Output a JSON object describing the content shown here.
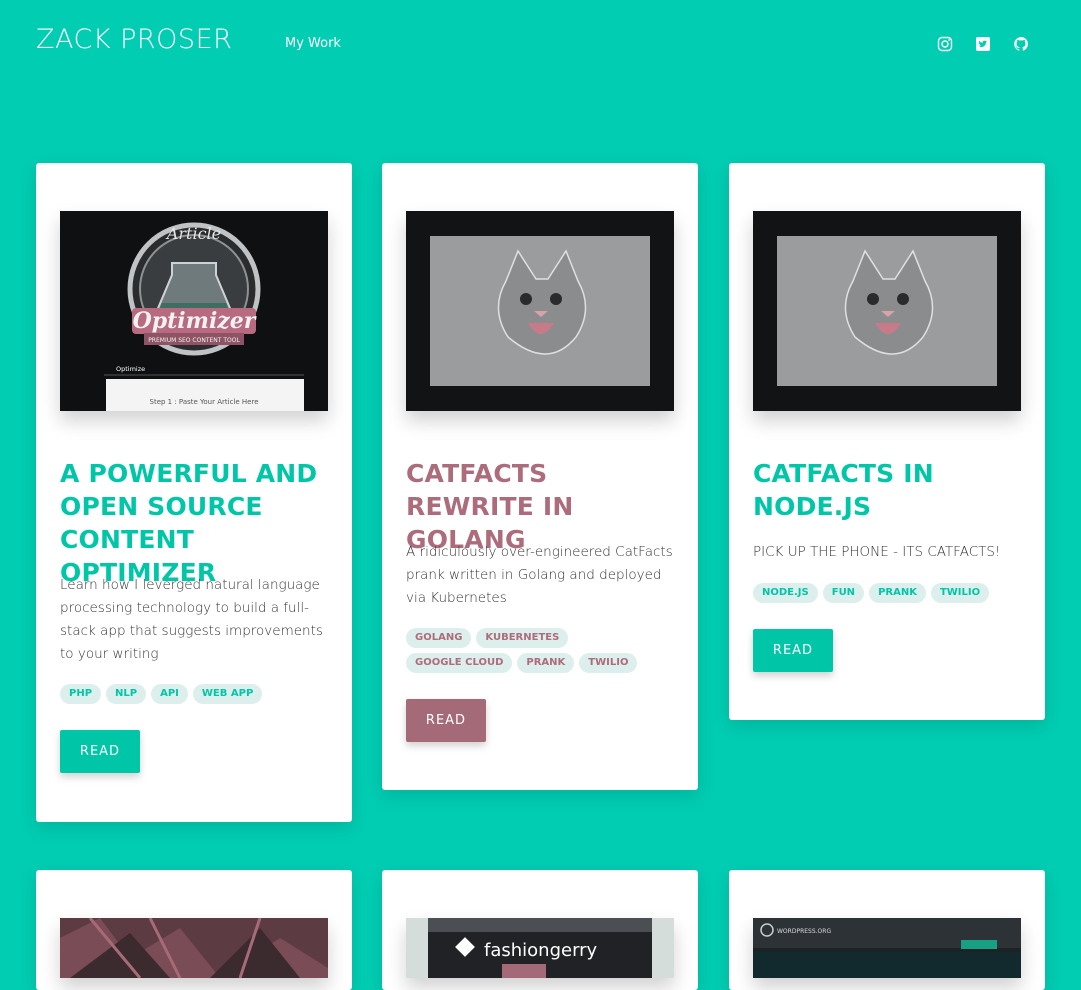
{
  "header": {
    "site_title": "ZACK PROSER",
    "nav_link": "My Work",
    "social_icons": [
      "instagram-icon",
      "twitter-icon",
      "github-icon"
    ]
  },
  "colors": {
    "background": "#00cdb2",
    "accent_green": "#00c6a8",
    "accent_mauve": "#a46a78"
  },
  "cards": [
    {
      "title": "A POWERFUL AND OPEN SOURCE CONTENT OPTIMIZER",
      "description": "Learn how I leverged natural language processing technology to build a full-stack app that suggests improvements to your writing",
      "tags": [
        "PHP",
        "NLP",
        "API",
        "WEB APP"
      ],
      "button": "READ",
      "image": {
        "logo_top": "Article",
        "logo_main": "Optimizer",
        "logo_banner": "PREMIUM SEO CONTENT TOOL",
        "tab_label": "Optimize",
        "step_text": "Step 1 : Paste Your Article Here"
      }
    },
    {
      "title": "CATFACTS REWRITE IN GOLANG",
      "description": "A ridiculously over-engineered CatFacts prank written in Golang and deployed via Kubernetes",
      "tags": [
        "GOLANG",
        "KUBERNETES",
        "GOOGLE CLOUD",
        "PRANK",
        "TWILIO"
      ],
      "button": "READ",
      "image": {}
    },
    {
      "title": "CATFACTS IN NODE.JS",
      "description": "PICK UP THE PHONE - ITS CATFACTS!",
      "tags": [
        "NODE.JS",
        "FUN",
        "PRANK",
        "TWILIO"
      ],
      "button": "READ",
      "image": {}
    }
  ],
  "bottom_cards": [
    {
      "image_text": ""
    },
    {
      "image_text": "fashiongerry"
    },
    {
      "image_text": "WORDPRESS.ORG"
    }
  ]
}
